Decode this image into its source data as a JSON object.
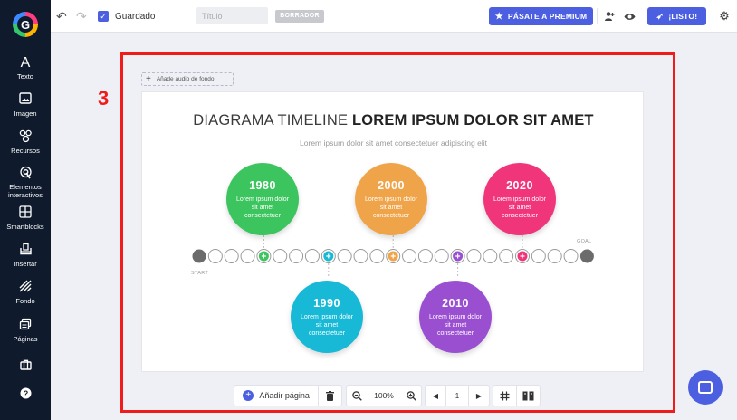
{
  "sidebar": {
    "items": [
      {
        "label": "Texto",
        "icon": "text-icon",
        "glyph": "A"
      },
      {
        "label": "Imagen",
        "icon": "image-icon",
        "glyph": "▨"
      },
      {
        "label": "Recursos",
        "icon": "resources-icon",
        "glyph": "⚇"
      },
      {
        "label": "Elementos interactivos",
        "icon": "interactive-icon",
        "glyph": "◎"
      },
      {
        "label": "Smartblocks",
        "icon": "smartblocks-icon",
        "glyph": "▦"
      },
      {
        "label": "Insertar",
        "icon": "insert-icon",
        "glyph": "⎘"
      },
      {
        "label": "Fondo",
        "icon": "background-icon",
        "glyph": "▤"
      },
      {
        "label": "Páginas",
        "icon": "pages-icon",
        "glyph": "❐"
      }
    ]
  },
  "topbar": {
    "saved_label": "Guardado",
    "title_placeholder": "Título",
    "draft_badge": "BORRADOR",
    "premium_label": "PÁSATE A PREMIUM",
    "ready_label": "¡LISTO!"
  },
  "canvas": {
    "step_number": "3",
    "audio_label": "Añade audio de fondo"
  },
  "slide": {
    "title_light": "DIAGRAMA TIMELINE ",
    "title_bold": "LOREM IPSUM DOLOR SIT AMET",
    "subtitle": "Lorem ipsum dolor sit amet consectetuer adipiscing elit",
    "start_label": "START",
    "goal_label": "GOAL",
    "milestones": [
      {
        "year": "1980",
        "text": "Lorem ipsum dolor sit amet consectetuer",
        "color": "#3cc45e"
      },
      {
        "year": "1990",
        "text": "Lorem ipsum dolor sit amet consectetuer",
        "color": "#17b9d6"
      },
      {
        "year": "2000",
        "text": "Lorem ipsum dolor sit amet consectetuer",
        "color": "#f0a44a"
      },
      {
        "year": "2010",
        "text": "Lorem ipsum dolor sit amet consectetuer",
        "color": "#9a4fd1"
      },
      {
        "year": "2020",
        "text": "Lorem ipsum dolor sit amet consectetuer",
        "color": "#f0357a"
      }
    ]
  },
  "bottombar": {
    "add_page_label": "Añadir página",
    "zoom": "100%",
    "page": "1"
  },
  "colors": {
    "accent": "#4b5fe0",
    "sidebar_bg": "#0f1b2d",
    "highlight": "#f01c1c"
  }
}
